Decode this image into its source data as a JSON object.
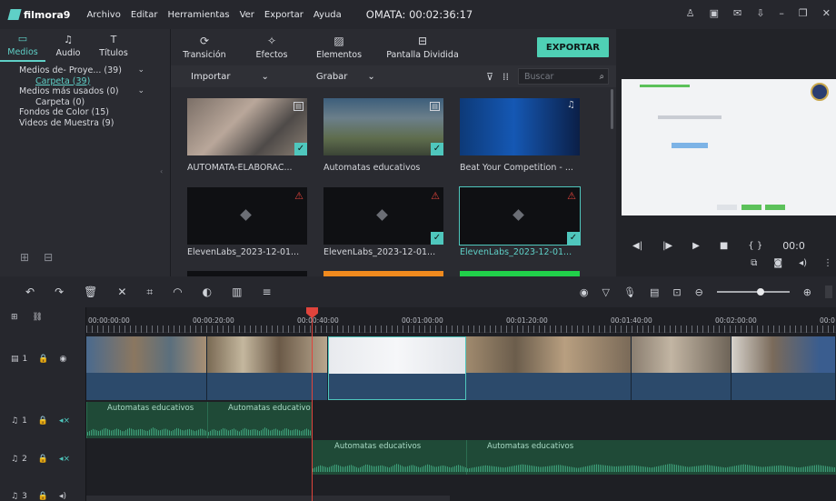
{
  "menubar": {
    "app": "filmora9",
    "items": [
      "Archivo",
      "Editar",
      "Herramientas",
      "Ver",
      "Exportar",
      "Ayuda"
    ],
    "title": "OMATA: 00:02:36:17",
    "window_icons": [
      "user-icon",
      "save-icon",
      "mail-icon",
      "download-icon",
      "minimize-icon",
      "restore-icon",
      "close-icon"
    ]
  },
  "left_tabs": [
    {
      "label": "Medios",
      "icon": "folder-icon",
      "active": true
    },
    {
      "label": "Audio",
      "icon": "music-note-icon"
    },
    {
      "label": "Títulos",
      "icon": "text-icon"
    }
  ],
  "top_tabs": [
    {
      "label": "Transición",
      "icon": "transition-icon"
    },
    {
      "label": "Efectos",
      "icon": "effects-icon"
    },
    {
      "label": "Elementos",
      "icon": "image-icon"
    },
    {
      "label": "Pantalla Dividida",
      "icon": "split-screen-icon"
    }
  ],
  "export_label": "EXPORTAR",
  "tree": [
    {
      "label": "Medios de- Proye... (39)",
      "level": 0,
      "chev": "⌄"
    },
    {
      "label": "Carpeta (39)",
      "level": 1,
      "active": true
    },
    {
      "label": "Medios más usados (0)",
      "level": 0,
      "chev": "⌄"
    },
    {
      "label": "Carpeta (0)",
      "level": 1
    },
    {
      "label": "Fondos de Color (15)",
      "level": 0
    },
    {
      "label": "Videos de Muestra (9)",
      "level": 0
    }
  ],
  "toolbar": {
    "importar": "Importar",
    "grabar": "Grabar",
    "search_placeholder": "Buscar"
  },
  "media": [
    {
      "caption": "AUTOMATA-ELABORAC...",
      "type": "video",
      "checked": true
    },
    {
      "caption": "Automatas educativos",
      "type": "video",
      "checked": true
    },
    {
      "caption": "Beat Your Competition - ...",
      "type": "audio",
      "checked": false
    },
    {
      "caption": "ElevenLabs_2023-12-01...",
      "type": "warn",
      "checked": false
    },
    {
      "caption": "ElevenLabs_2023-12-01...",
      "type": "warn",
      "checked": true
    },
    {
      "caption": "ElevenLabs_2023-12-01...",
      "type": "warn",
      "checked": true,
      "selected": true
    }
  ],
  "preview": {
    "timecode": "00:0"
  },
  "ruler_labels": [
    "00:00:00:00",
    "00:00:20:00",
    "00:00:40:00",
    "00:01:00:00",
    "00:01:20:00",
    "00:01:40:00",
    "00:02:00:00",
    "00:0"
  ],
  "tracks": [
    {
      "name": "1",
      "kind": "video"
    },
    {
      "name": "1",
      "kind": "audio"
    },
    {
      "name": "2",
      "kind": "audio"
    },
    {
      "name": "3",
      "kind": "audio"
    }
  ],
  "audio_clips": {
    "track1": [
      "Automatas educativos",
      "Automatas educativo"
    ],
    "track2": [
      "Automatas educativos",
      "Automatas educativos"
    ]
  },
  "colors": {
    "accent": "#5fd0c7",
    "export": "#4fd0b5",
    "playhead": "#e0443c",
    "video_clip": "#2c4a6b",
    "audio_clip": "#1f4a37"
  }
}
